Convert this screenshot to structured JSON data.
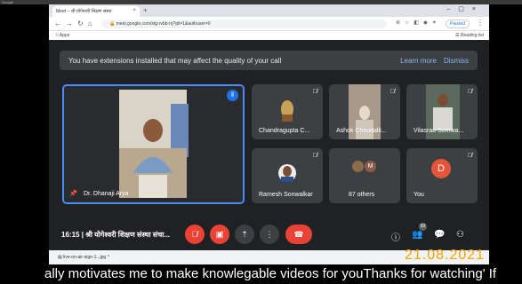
{
  "os_top_label": "Google",
  "browser": {
    "tab_title": "Meet – श्री योगेश्वरी शिक्षण संस्था",
    "address": "meet.google.com/xtg-rvbb-rrj?pli=1&authuser=0",
    "paused_label": "Paused",
    "bookmarks": {
      "apps": "Apps",
      "reading_list": "Reading list"
    }
  },
  "meet": {
    "banner": {
      "message": "You have extensions installed that may affect the quality of your call",
      "learn_more": "Learn more",
      "dismiss": "Dismiss"
    },
    "tiles": {
      "main": {
        "name": "Dr. Dhanaji Arya"
      },
      "t1": {
        "name": "Chandragupta C..."
      },
      "t2": {
        "name": "Ashok Choudalk..."
      },
      "t3": {
        "name": "Vilasrao Somwa..."
      },
      "t4": {
        "name": "Ramesh Sonwalkar"
      },
      "t5": {
        "name": "87 others",
        "avatar_letter": "M"
      },
      "t6": {
        "name": "You",
        "avatar_letter": "D"
      }
    },
    "bottom": {
      "time": "16:15",
      "separator": "|",
      "meeting_name": "श्री योगेश्वरी शिक्षण संस्था संचा...",
      "participants_badge": "93"
    }
  },
  "downloads": {
    "item": "live-on-air-sign-1...jpg",
    "chevron": "^"
  },
  "date_stamp": "21.08.2021",
  "caption": "ally motivates me to make knowlegable videos for youThanks for watching' If",
  "colors": {
    "accent": "#1a73e8",
    "danger": "#ea4335",
    "stamp": "#f0a400"
  }
}
